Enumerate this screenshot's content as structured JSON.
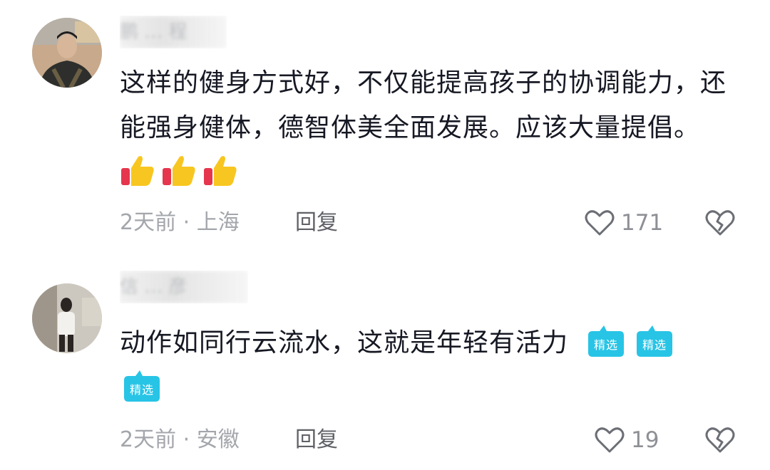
{
  "comments": [
    {
      "username": "鹏 … 程",
      "text": "这样的健身方式好，不仅能提高孩子的协调能力，还能强身健体，德智体美全面发展。应该大量提倡。",
      "emojis": [
        "thumbs-up",
        "thumbs-up",
        "thumbs-up"
      ],
      "time": "2天前",
      "location": "上海",
      "reply_label": "回复",
      "likes": "171"
    },
    {
      "username": "信 … 彦",
      "text": "动作如同行云流水，这就是年轻有活力",
      "badges": [
        "精选",
        "精选",
        "精选"
      ],
      "time": "2天前",
      "location": "安徽",
      "reply_label": "回复",
      "likes": "19"
    }
  ],
  "separator": " · ",
  "colors": {
    "text": "#161823",
    "meta": "#a3a6ab",
    "reply": "#5f6167",
    "badge": "#27c4e6"
  }
}
